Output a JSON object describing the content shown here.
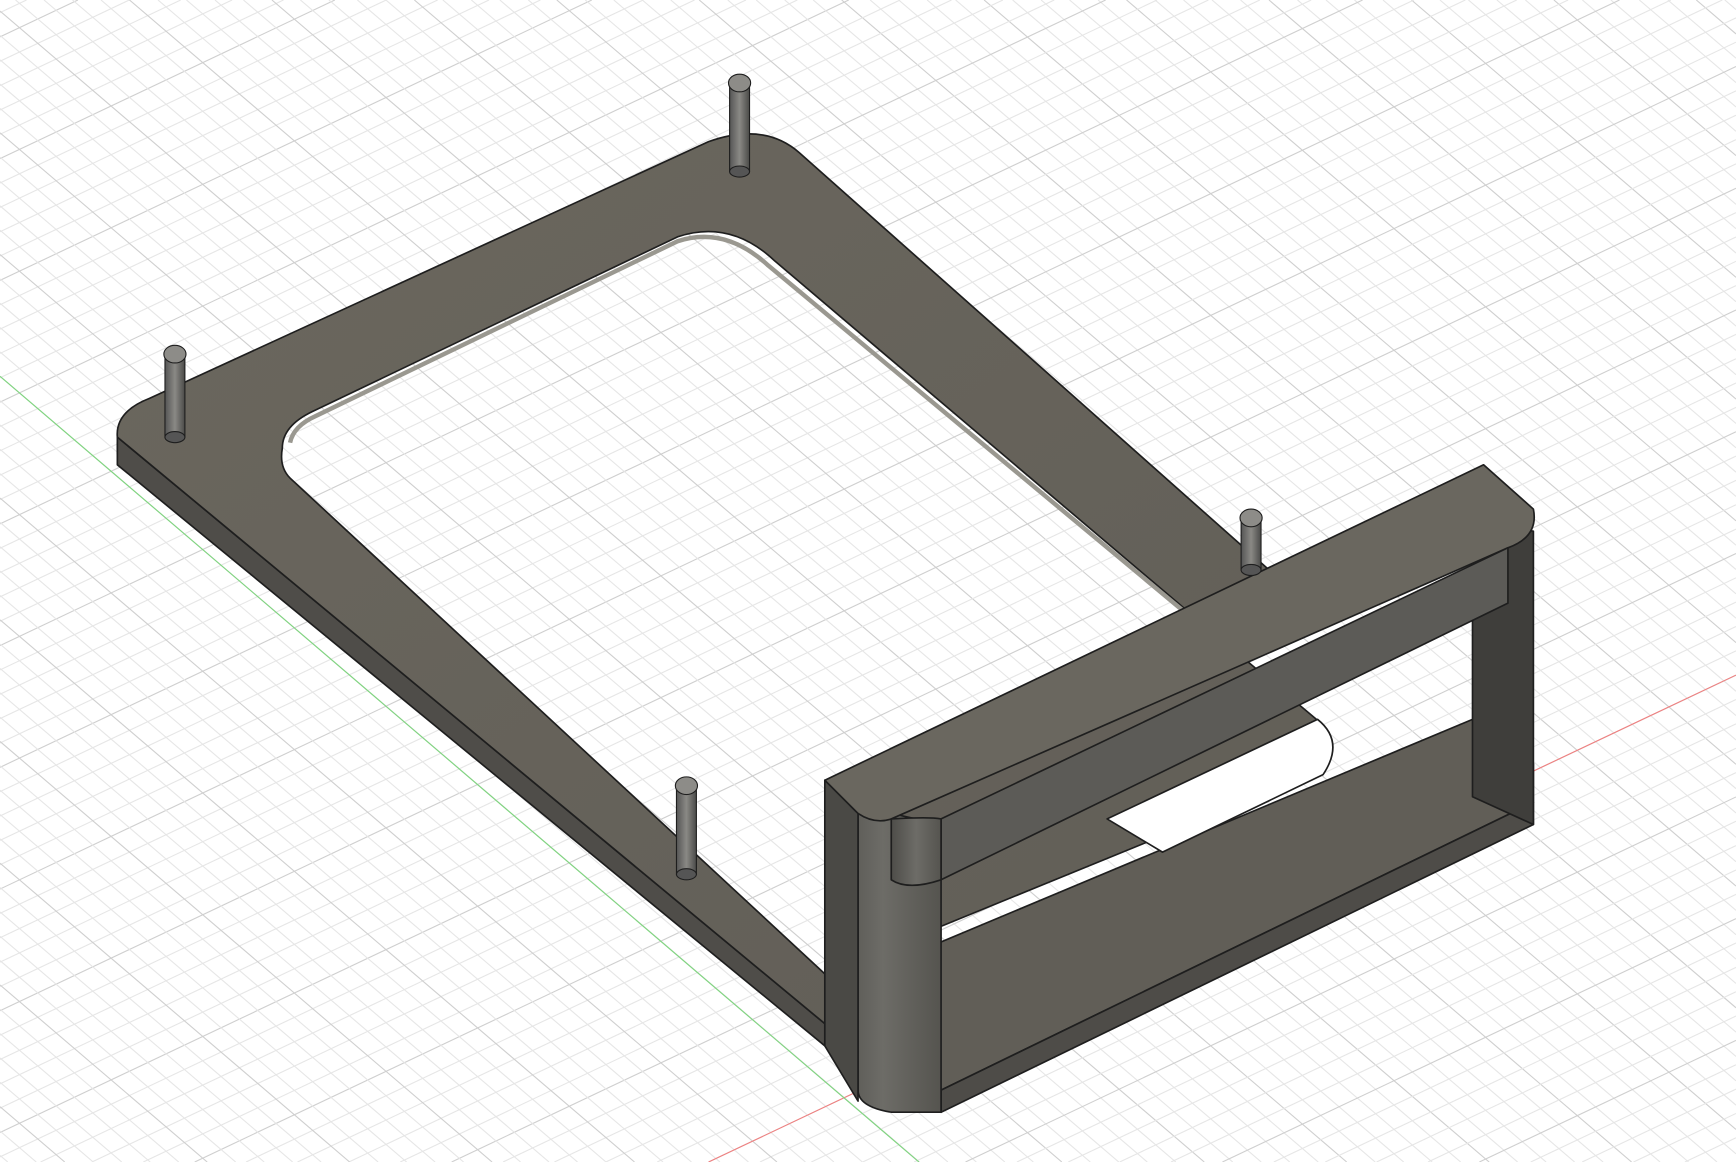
{
  "viewport": {
    "background_color": "#ffffff",
    "grid_minor_color": "#e6e6e6",
    "grid_major_color": "#cfcfcf",
    "x_axis_color": "#f08080",
    "y_axis_color": "#7fd67f"
  },
  "model": {
    "body_color": "#66625a",
    "edge_color": "#1e1e1e",
    "side_color": "#55534e",
    "pin_color": "#6c6b68",
    "pin_count": 4
  }
}
